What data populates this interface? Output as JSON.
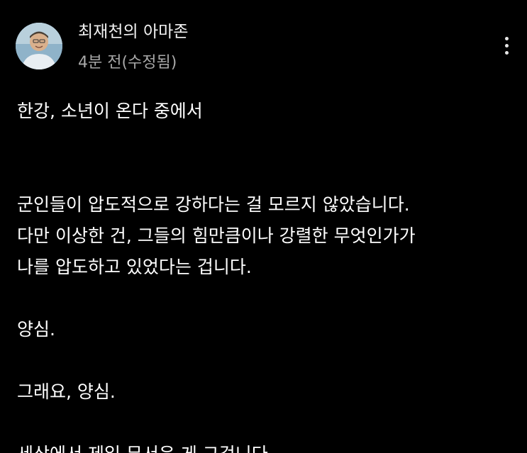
{
  "header": {
    "author_name": "최재천의 아마존",
    "time_text": "4분 전(수정됨)",
    "avatar_icon": "profile-photo",
    "more_icon": "more-vertical-icon"
  },
  "post": {
    "title_line": "한강, 소년이 온다 중에서",
    "lines": [
      "군인들이 압도적으로 강하다는 걸 모르지 않았습니다.",
      "다만 이상한 건, 그들의 힘만큼이나 강렬한 무엇인가가",
      "나를 압도하고 있었다는 겁니다.",
      "양심.",
      "그래요, 양심.",
      "세상에서 제일 무서운 게 그겁니다."
    ]
  },
  "colors": {
    "background": "#000000",
    "text_primary": "#ffffff",
    "text_secondary": "#a8a8a8"
  }
}
